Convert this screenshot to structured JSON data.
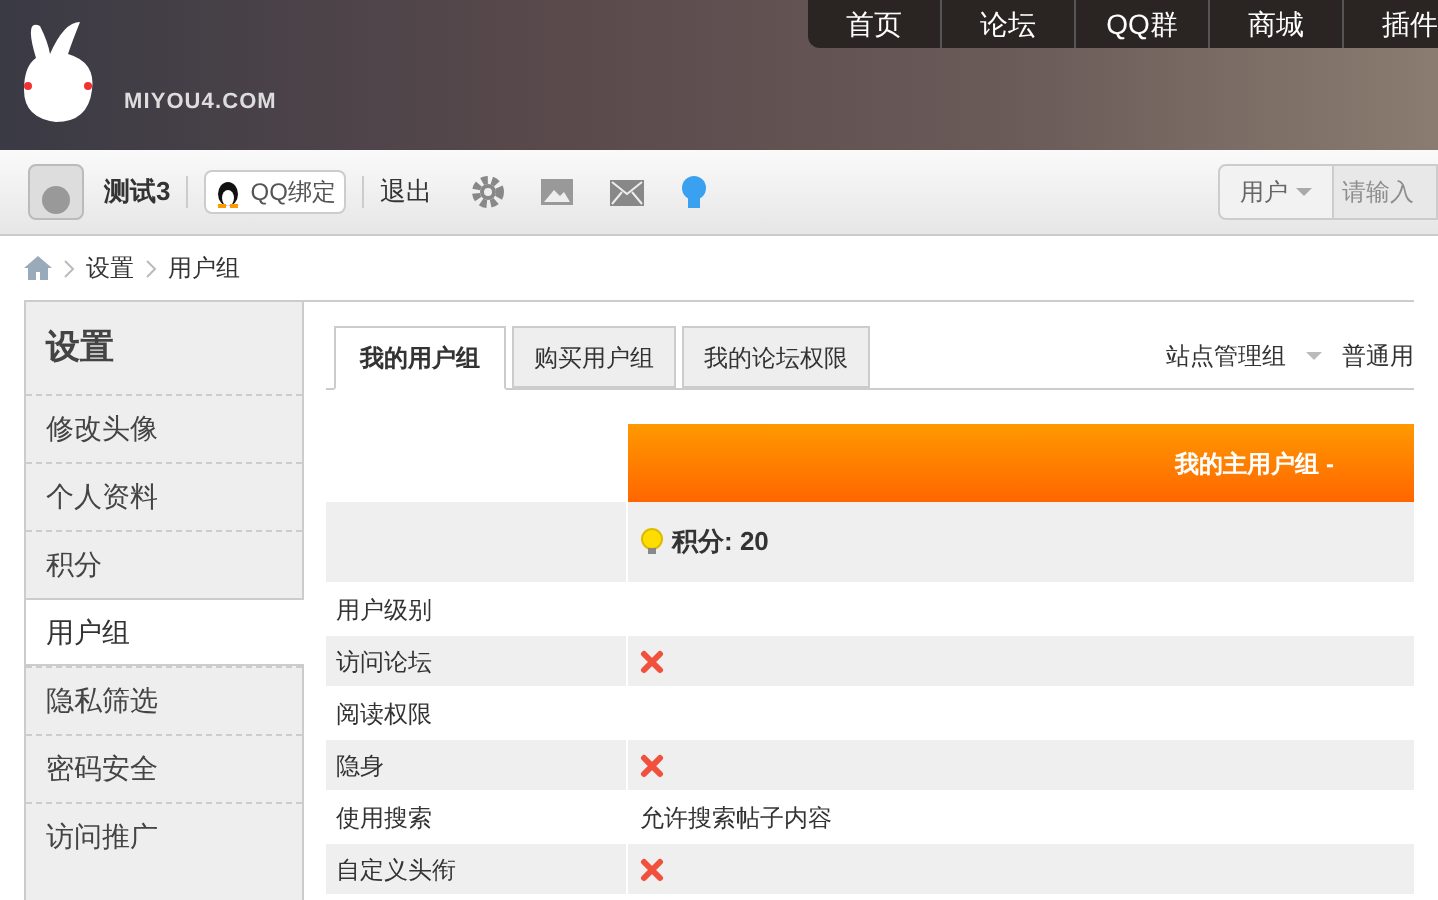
{
  "header": {
    "logo_text": "MIYOU4.COM",
    "nav": [
      {
        "label": "首页"
      },
      {
        "label": "论坛"
      },
      {
        "label": "QQ群"
      },
      {
        "label": "商城"
      },
      {
        "label": "插件"
      }
    ]
  },
  "toolbar": {
    "username": "测试3",
    "qq_button": "QQ绑定",
    "logout": "退出",
    "search_type": "用户",
    "search_placeholder": "请输入"
  },
  "breadcrumb": [
    "设置",
    "用户组"
  ],
  "sidebar": {
    "title": "设置",
    "items": [
      {
        "label": "修改头像",
        "selected": false
      },
      {
        "label": "个人资料",
        "selected": false
      },
      {
        "label": "积分",
        "selected": false
      },
      {
        "label": "用户组",
        "selected": true
      },
      {
        "label": "隐私筛选",
        "selected": false
      },
      {
        "label": "密码安全",
        "selected": false
      },
      {
        "label": "访问推广",
        "selected": false
      }
    ]
  },
  "tabs": [
    {
      "label": "我的用户组",
      "selected": true
    },
    {
      "label": "购买用户组",
      "selected": false
    },
    {
      "label": "我的论坛权限",
      "selected": false
    }
  ],
  "group_switch": {
    "current": "站点管理组",
    "next": "普通用"
  },
  "table": {
    "header": "我的主用户组 -",
    "points": "积分: 20",
    "rows": [
      {
        "label": "用户级别",
        "kind": "empty"
      },
      {
        "label": "访问论坛",
        "kind": "cross"
      },
      {
        "label": "阅读权限",
        "kind": "empty"
      },
      {
        "label": "隐身",
        "kind": "cross"
      },
      {
        "label": "使用搜索",
        "kind": "text",
        "value": "允许搜索帖子内容"
      },
      {
        "label": "自定义头衔",
        "kind": "cross"
      }
    ]
  }
}
